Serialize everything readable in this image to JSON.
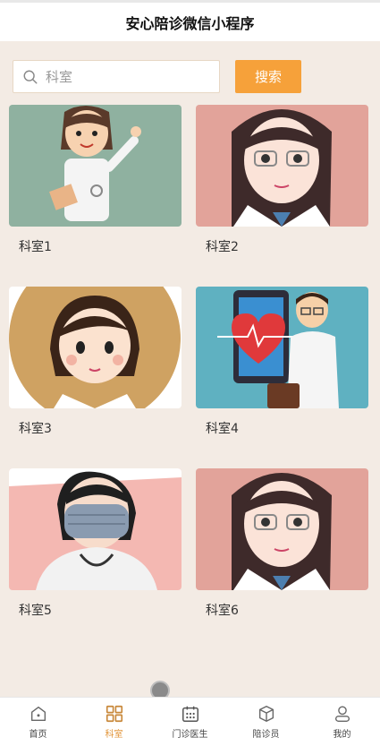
{
  "header": {
    "title": "安心陪诊微信小程序"
  },
  "search": {
    "placeholder": "科室",
    "button_label": "搜索"
  },
  "departments": [
    {
      "label": "科室1"
    },
    {
      "label": "科室2"
    },
    {
      "label": "科室3"
    },
    {
      "label": "科室4"
    },
    {
      "label": "科室5"
    },
    {
      "label": "科室6"
    }
  ],
  "tabbar": [
    {
      "label": "首页",
      "icon": "home-icon",
      "active": false
    },
    {
      "label": "科室",
      "icon": "grid-icon",
      "active": true
    },
    {
      "label": "门诊医生",
      "icon": "calendar-icon",
      "active": false
    },
    {
      "label": "陪诊员",
      "icon": "box-icon",
      "active": false
    },
    {
      "label": "我的",
      "icon": "user-icon",
      "active": false
    }
  ],
  "colors": {
    "accent": "#f6a13a",
    "active_tab": "#e2953a",
    "background": "#f3ebe4"
  }
}
